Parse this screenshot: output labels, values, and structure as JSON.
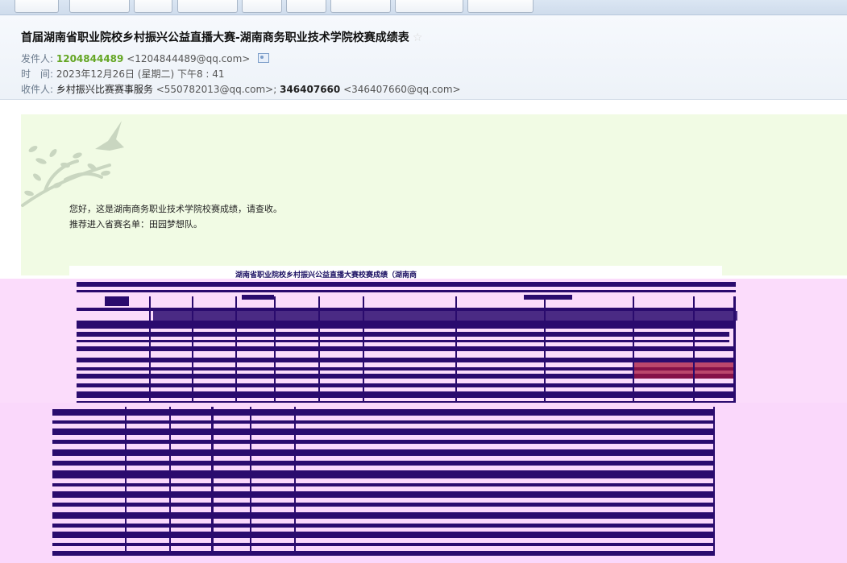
{
  "email": {
    "subject": "首届湖南省职业院校乡村振兴公益直播大赛-湖南商务职业技术学院校赛成绩表",
    "star_icon": "star-icon",
    "sender_label": "发件人:",
    "sender_name": "1204844489",
    "sender_email": "<1204844489@qq.com>",
    "time_label": "时　间:",
    "time_value": "2023年12月26日 (星期二) 下午8 : 41",
    "recipients_label": "收件人:",
    "recipient1_name": "乡村振兴比赛赛事服务",
    "recipient1_email": "<550782013@qq.com>;",
    "recipient2_name": "346407660",
    "recipient2_email": "<346407660@qq.com>"
  },
  "body": {
    "line1": "您好，这是湖南商务职业技术学院校赛成绩，请查收。",
    "line2": "推荐进入省赛名单：田园梦想队。"
  },
  "table": {
    "title": "湖南省职业院校乡村振兴公益直播大赛校赛成绩（湖南商"
  },
  "colors": {
    "accent_green": "#64a624",
    "header_bg": "#edf2f8",
    "body_bg": "#f1fbe4",
    "glitch_bg": "#fbdcfb",
    "glitch_dark": "#2a0b6e"
  }
}
